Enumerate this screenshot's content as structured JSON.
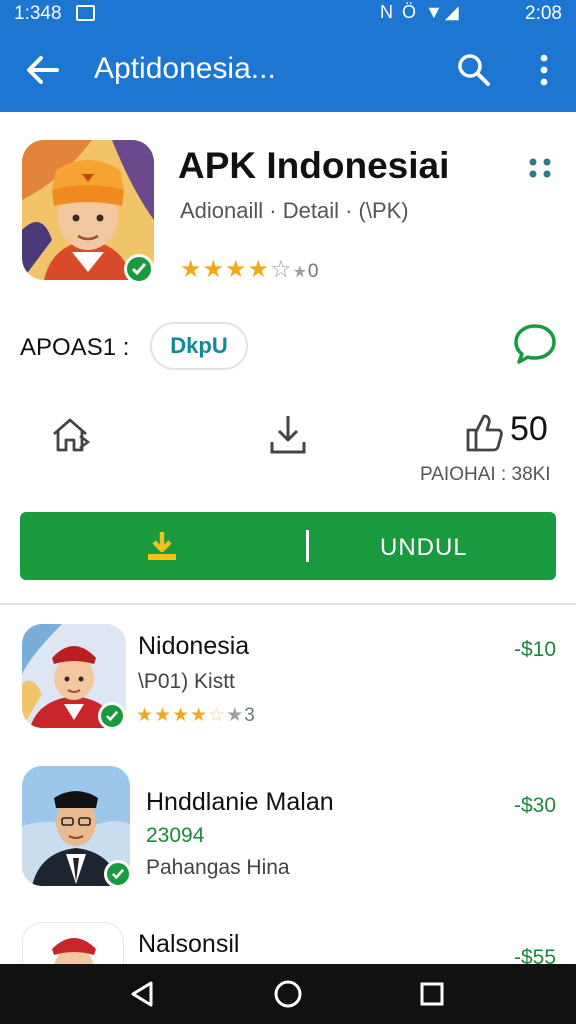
{
  "status_bar": {
    "time": "1:348",
    "network_icons": "N Ö ▼◢",
    "clock": "2:08"
  },
  "app_bar": {
    "title": "Aptidonesia..."
  },
  "app": {
    "title": "APK Indonesiai",
    "subtitle": "Adionaill · Detail · (\\PK)",
    "rating_count": "0",
    "rating_stars": 4
  },
  "meta_row": {
    "label": "APOAS1 :",
    "chip_text": "DkpU"
  },
  "stats": {
    "count": "50",
    "label": "PAIOHAI : 38KI"
  },
  "install": {
    "label": "UNDUL"
  },
  "list": [
    {
      "title": "Nidonesia",
      "subtitle": "\\P01) Kistt",
      "rating_count": "3",
      "rating_stars": 4,
      "price": "-$10"
    },
    {
      "title": "Hnddlanie Malan",
      "subtitle": "23094",
      "subtitle2": "Pahangas Hina",
      "price": "-$30"
    },
    {
      "title": "Nalsonsil",
      "price": "-$55"
    }
  ],
  "colors": {
    "primary": "#1d76d2",
    "accent_green": "#1a9a3f",
    "chip_teal": "#0f8a96",
    "star": "#f3a81c"
  }
}
